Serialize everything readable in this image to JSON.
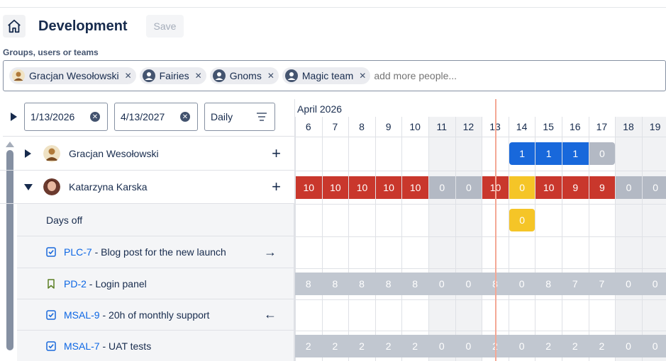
{
  "header": {
    "title": "Development",
    "save_label": "Save",
    "people_label": "Groups, users or teams",
    "chips": [
      {
        "label": "Gracjan Wesołowski",
        "icon": "user-photo"
      },
      {
        "label": "Fairies",
        "icon": "person-icon"
      },
      {
        "label": "Gnoms",
        "icon": "person-icon"
      },
      {
        "label": "Magic team",
        "icon": "person-icon"
      }
    ],
    "people_placeholder": "add more people..."
  },
  "controls": {
    "start_date": "1/13/2026",
    "end_date": "4/13/2027",
    "granularity": "Daily"
  },
  "timeline": {
    "month": "April 2026",
    "days": [
      {
        "num": "6",
        "weekend": false
      },
      {
        "num": "7",
        "weekend": false
      },
      {
        "num": "8",
        "weekend": false
      },
      {
        "num": "9",
        "weekend": false
      },
      {
        "num": "10",
        "weekend": false
      },
      {
        "num": "11",
        "weekend": true
      },
      {
        "num": "12",
        "weekend": true
      },
      {
        "num": "13",
        "weekend": false
      },
      {
        "num": "14",
        "weekend": false
      },
      {
        "num": "15",
        "weekend": false
      },
      {
        "num": "16",
        "weekend": false
      },
      {
        "num": "17",
        "weekend": false
      },
      {
        "num": "18",
        "weekend": true
      },
      {
        "num": "19",
        "weekend": true
      }
    ],
    "today_index": 7
  },
  "rows": [
    {
      "type": "user",
      "name": "Gracjan Wesołowski",
      "expanded": false,
      "cells": [
        "",
        "",
        "",
        "",
        "",
        "",
        "",
        "",
        "1",
        "1",
        "1",
        "0",
        "",
        ""
      ],
      "colors": [
        "",
        "",
        "",
        "",
        "",
        "",
        "",
        "",
        "blue",
        "blue",
        "blue",
        "gray",
        "",
        ""
      ]
    },
    {
      "type": "user",
      "name": "Katarzyna Karska",
      "expanded": true,
      "cells": [
        "10",
        "10",
        "10",
        "10",
        "10",
        "0",
        "0",
        "10",
        "0",
        "10",
        "9",
        "9",
        "0",
        "0"
      ],
      "colors": [
        "red",
        "red",
        "red",
        "red",
        "red",
        "gray",
        "gray",
        "red",
        "yellow",
        "red",
        "red",
        "red",
        "gray",
        "gray"
      ]
    },
    {
      "type": "daysoff",
      "label": "Days off",
      "cells": [
        "",
        "",
        "",
        "",
        "",
        "",
        "",
        "",
        "0",
        "",
        "",
        "",
        "",
        ""
      ],
      "colors": [
        "",
        "",
        "",
        "",
        "",
        "",
        "",
        "",
        "yellow",
        "",
        "",
        "",
        "",
        ""
      ]
    },
    {
      "type": "task",
      "key": "PLC-7",
      "title": "Blog post for the new launch",
      "icon": "checkbox",
      "arrow": "→",
      "cells": [
        "",
        "",
        "",
        "",
        "",
        "",
        "",
        "",
        "",
        "",
        "",
        "",
        "",
        ""
      ],
      "colors": [
        "",
        "",
        "",
        "",
        "",
        "",
        "",
        "",
        "",
        "",
        "",
        "",
        "",
        ""
      ]
    },
    {
      "type": "task",
      "key": "PD-2",
      "title": "Login panel",
      "icon": "bookmark",
      "arrow": "",
      "cells": [
        "8",
        "8",
        "8",
        "8",
        "8",
        "0",
        "0",
        "8",
        "0",
        "8",
        "7",
        "7",
        "0",
        "0"
      ],
      "colors": [
        "lgray",
        "lgray",
        "lgray",
        "lgray",
        "lgray",
        "lgray",
        "lgray",
        "lgray",
        "lgray",
        "lgray",
        "lgray",
        "lgray",
        "lgray",
        "lgray"
      ]
    },
    {
      "type": "task",
      "key": "MSAL-9",
      "title": "20h of monthly support",
      "icon": "checkbox",
      "arrow": "←",
      "cells": [
        "",
        "",
        "",
        "",
        "",
        "",
        "",
        "",
        "",
        "",
        "",
        "",
        "",
        ""
      ],
      "colors": [
        "",
        "",
        "",
        "",
        "",
        "",
        "",
        "",
        "",
        "",
        "",
        "",
        "",
        ""
      ]
    },
    {
      "type": "task",
      "key": "MSAL-7",
      "title": "UAT tests",
      "icon": "checkbox",
      "arrow": "",
      "cells": [
        "2",
        "2",
        "2",
        "2",
        "2",
        "0",
        "0",
        "2",
        "0",
        "2",
        "2",
        "2",
        "0",
        "0"
      ],
      "colors": [
        "lgray",
        "lgray",
        "lgray",
        "lgray",
        "lgray",
        "lgray",
        "lgray",
        "lgray",
        "lgray",
        "lgray",
        "lgray",
        "lgray",
        "lgray",
        "lgray"
      ]
    }
  ],
  "colors": {
    "blue": "#1868db",
    "red": "#c9372c",
    "yellow": "#f5c527",
    "gray": "#b3b9c4",
    "lgray": "#c1c7d0",
    "today": "#f4a896"
  }
}
